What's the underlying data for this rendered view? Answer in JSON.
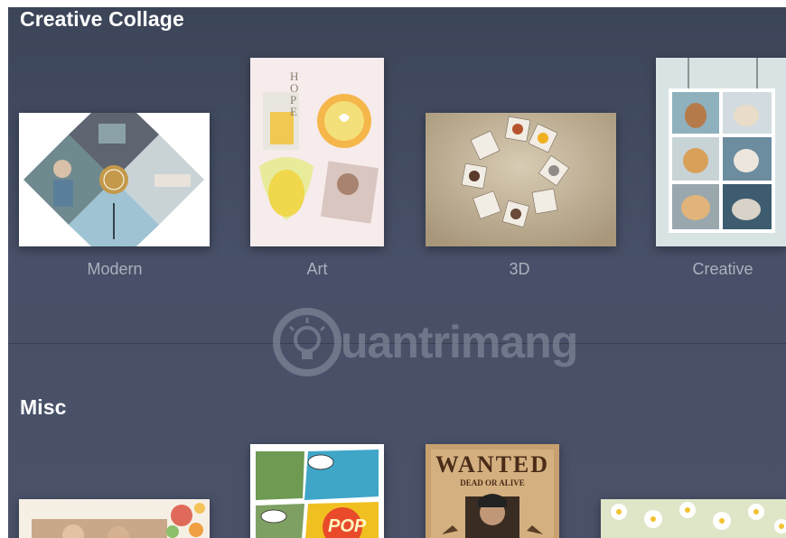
{
  "sections": [
    {
      "title": "Creative Collage",
      "items": [
        {
          "label": "Modern",
          "thumb_icon": "modern-collage-thumbnail"
        },
        {
          "label": "Art",
          "thumb_icon": "art-hope-collage-thumbnail",
          "thumb_text": "HOPE"
        },
        {
          "label": "3D",
          "thumb_icon": "3d-cubes-collage-thumbnail"
        },
        {
          "label": "Creative",
          "thumb_icon": "dogs-photo-grid-thumbnail"
        }
      ]
    },
    {
      "title": "Misc",
      "items": [
        {
          "thumb_icon": "floral-frame-thumbnail"
        },
        {
          "thumb_icon": "comic-pop-thumbnail",
          "thumb_text": "POP"
        },
        {
          "thumb_icon": "wanted-poster-thumbnail",
          "thumb_text": "WANTED",
          "thumb_subtext": "DEAD OR ALIVE"
        },
        {
          "thumb_icon": "daisy-flowers-thumbnail"
        }
      ]
    }
  ],
  "watermark": {
    "text": "uantrimang",
    "icon": "lightbulb-logo-icon"
  },
  "colors": {
    "background": "#475068",
    "title": "#ffffff",
    "label": "#aab0bd"
  }
}
